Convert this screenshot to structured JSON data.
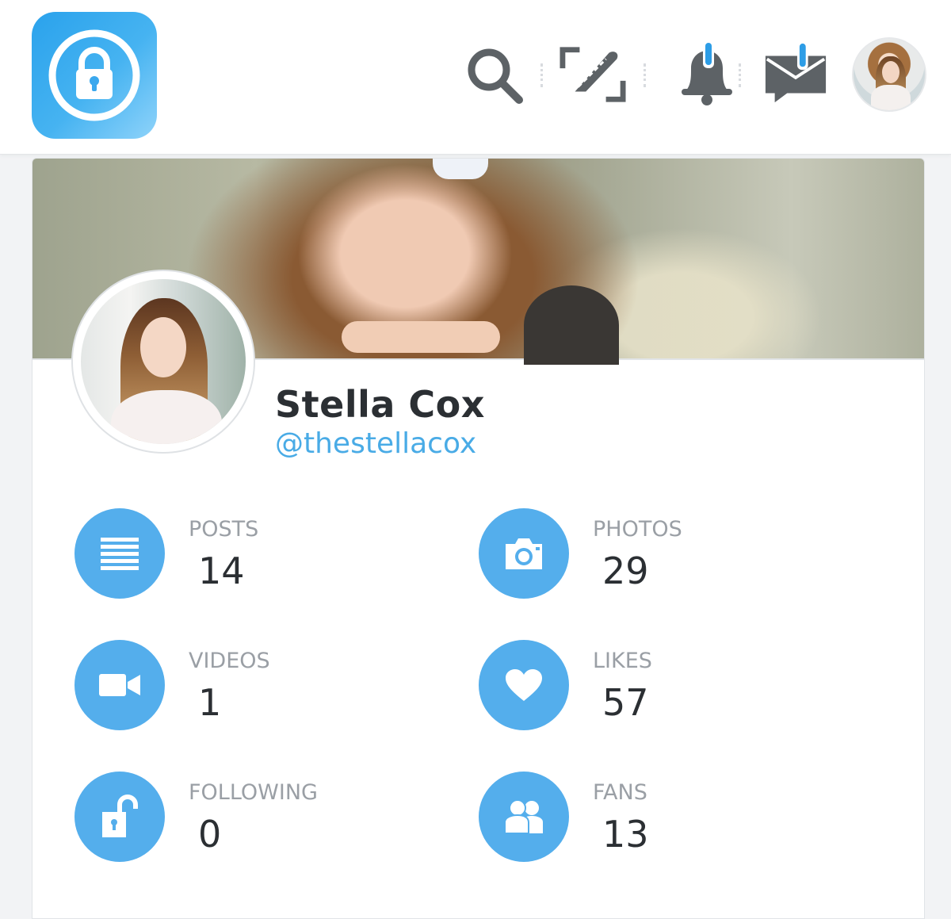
{
  "header": {
    "logo_icon": "lock-icon",
    "nav_icons": [
      "search-icon",
      "new-post-icon",
      "notifications-bell-icon",
      "messages-icon"
    ],
    "colors": {
      "accent": "#54aeec",
      "icon_gray": "#5d6266",
      "badge_blue": "#2d9de6"
    }
  },
  "profile": {
    "display_name": "Stella Cox",
    "username": "@thestellacox"
  },
  "stats": [
    {
      "label": "POSTS",
      "value": "14",
      "icon": "list-icon"
    },
    {
      "label": "PHOTOS",
      "value": "29",
      "icon": "camera-icon"
    },
    {
      "label": "VIDEOS",
      "value": "1",
      "icon": "video-camera-icon"
    },
    {
      "label": "LIKES",
      "value": "57",
      "icon": "heart-icon"
    },
    {
      "label": "FOLLOWING",
      "value": "0",
      "icon": "unlocked-padlock-icon"
    },
    {
      "label": "FANS",
      "value": "13",
      "icon": "users-icon"
    }
  ]
}
